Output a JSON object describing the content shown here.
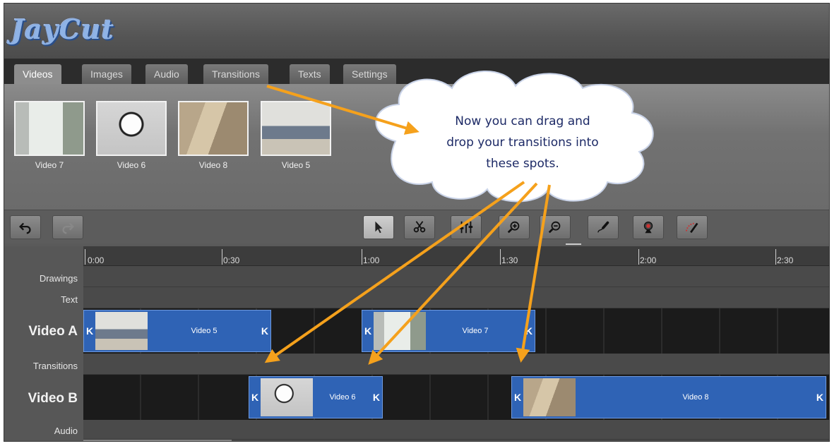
{
  "app": {
    "logo": "JayCut"
  },
  "tabs": [
    {
      "label": "Videos",
      "active": true
    },
    {
      "label": "Images",
      "active": false
    },
    {
      "label": "Audio",
      "active": false
    },
    {
      "label": "Transitions",
      "active": false
    },
    {
      "label": "Texts",
      "active": false
    },
    {
      "label": "Settings",
      "active": false
    }
  ],
  "bin": {
    "items": [
      {
        "label": "Video 7"
      },
      {
        "label": "Video 6"
      },
      {
        "label": "Video 8"
      },
      {
        "label": "Video 5"
      }
    ]
  },
  "toolbar": {
    "left": [
      {
        "icon": "undo-icon"
      },
      {
        "icon": "redo-icon"
      }
    ],
    "tools": [
      {
        "icon": "select-arrow-icon",
        "pressed": true
      },
      {
        "icon": "cut-scissors-icon"
      },
      {
        "icon": "mixer-sliders-icon"
      },
      {
        "icon": "zoom-in-icon"
      },
      {
        "icon": "zoom-out-icon"
      },
      {
        "icon": "microphone-icon"
      },
      {
        "icon": "webcam-icon"
      },
      {
        "icon": "draw-brush-icon"
      }
    ]
  },
  "timeline": {
    "ruler": [
      "0:00",
      "0:30",
      "1:00",
      "1:30",
      "2:00",
      "2:30"
    ],
    "tracks": {
      "drawings": "Drawings",
      "text": "Text",
      "video_a": "Video A",
      "transitions": "Transitions",
      "video_b": "Video B",
      "audio": "Audio"
    },
    "clips_a": [
      {
        "label": "Video 5"
      },
      {
        "label": "Video 7"
      }
    ],
    "clips_b": [
      {
        "label": "Video 6"
      },
      {
        "label": "Video 8"
      }
    ],
    "clip_color": "#2f63b5"
  },
  "callout": {
    "lines": [
      "Now you can drag and",
      "drop your transitions into",
      "these spots."
    ],
    "arrow_color": "#f5a11c"
  }
}
